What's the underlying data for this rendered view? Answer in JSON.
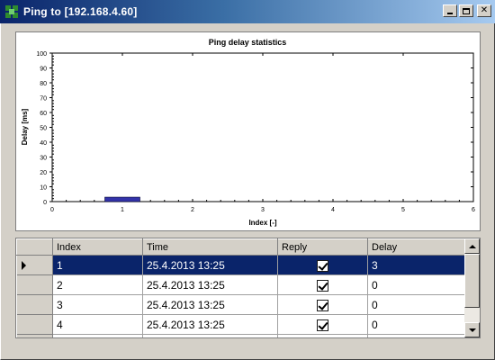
{
  "window": {
    "title": "Ping to  [192.168.4.60]",
    "minimize_icon": "minimize-icon",
    "maximize_icon": "maximize-icon",
    "close_icon": "close-icon"
  },
  "chart_data": {
    "type": "bar",
    "title": "Ping delay statistics",
    "xlabel": "Index [-]",
    "ylabel": "Delay [ms]",
    "xlim": [
      0,
      6
    ],
    "ylim": [
      0,
      100
    ],
    "x_ticks": [
      "0",
      "1",
      "2",
      "3",
      "4",
      "5",
      "6"
    ],
    "y_ticks": [
      "0",
      "10",
      "20",
      "30",
      "40",
      "50",
      "60",
      "70",
      "80",
      "90",
      "100"
    ],
    "categories": [
      1,
      2,
      3,
      4
    ],
    "values": [
      3,
      0,
      0,
      0
    ],
    "bar_color": "#3333aa",
    "grid": false
  },
  "grid": {
    "columns": [
      "Index",
      "Time",
      "Reply",
      "Delay"
    ],
    "rows": [
      {
        "index": "1",
        "time": "25.4.2013 13:25",
        "reply": true,
        "delay": "3",
        "selected": true
      },
      {
        "index": "2",
        "time": "25.4.2013 13:25",
        "reply": true,
        "delay": "0",
        "selected": false
      },
      {
        "index": "3",
        "time": "25.4.2013 13:25",
        "reply": true,
        "delay": "0",
        "selected": false
      },
      {
        "index": "4",
        "time": "25.4.2013 13:25",
        "reply": true,
        "delay": "0",
        "selected": false
      }
    ],
    "selection_color": "#0a246a"
  }
}
